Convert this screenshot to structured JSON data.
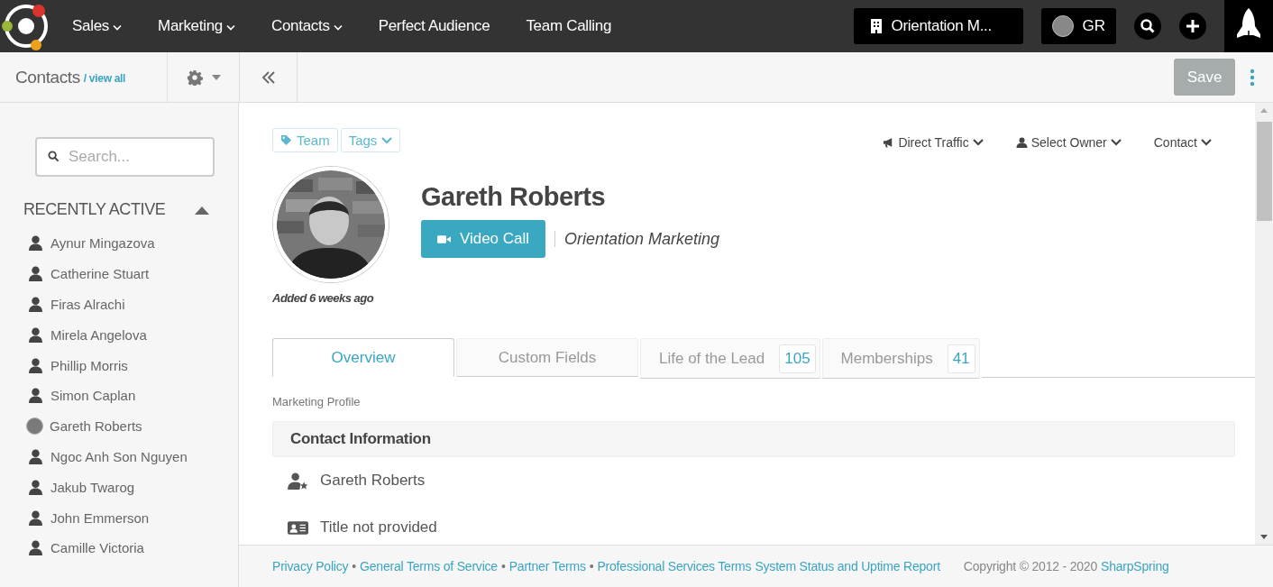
{
  "nav": {
    "menus": [
      {
        "label": "Sales",
        "dropdown": true
      },
      {
        "label": "Marketing",
        "dropdown": true
      },
      {
        "label": "Contacts",
        "dropdown": true
      },
      {
        "label": "Perfect Audience",
        "dropdown": false
      },
      {
        "label": "Team Calling",
        "dropdown": false
      }
    ],
    "company": "Orientation M...",
    "user_initials": "GR"
  },
  "toolbar": {
    "title": "Contacts",
    "view_all": "/ view all",
    "save": {
      "label": "Save",
      "disabled": true
    }
  },
  "sidebar": {
    "search": {
      "placeholder": "Search..."
    },
    "section": {
      "title": "RECENTLY ACTIVE",
      "expanded": true
    },
    "items": [
      {
        "name": "Aynur Mingazova",
        "kind": "person"
      },
      {
        "name": "Catherine Stuart",
        "kind": "person"
      },
      {
        "name": "Firas Alrachi",
        "kind": "person"
      },
      {
        "name": "Mirela Angelova",
        "kind": "person"
      },
      {
        "name": "Phillip Morris",
        "kind": "person"
      },
      {
        "name": "Simon Caplan",
        "kind": "person"
      },
      {
        "name": "Gareth Roberts",
        "kind": "avatar"
      },
      {
        "name": "Ngoc Anh Son Nguyen",
        "kind": "person"
      },
      {
        "name": "Jakub Twarog",
        "kind": "person"
      },
      {
        "name": "John Emmerson",
        "kind": "person"
      },
      {
        "name": "Camille Victoria",
        "kind": "person"
      }
    ]
  },
  "contact": {
    "tags": [
      {
        "label": "Team",
        "kind": "tag"
      },
      {
        "label": "Tags",
        "kind": "dropdown"
      }
    ],
    "selectors": [
      {
        "label": "Direct Traffic",
        "kind": "source"
      },
      {
        "label": "Select Owner",
        "kind": "owner"
      },
      {
        "label": "Contact",
        "kind": "plain"
      }
    ],
    "name": "Gareth Roberts",
    "video_call": "Video Call",
    "company": "Orientation Marketing",
    "added": "Added 6 weeks ago"
  },
  "tabs": [
    {
      "label": "Overview",
      "selected": true
    },
    {
      "label": "Custom Fields",
      "selected": false
    },
    {
      "label": "Life of the Lead",
      "count": "105",
      "selected": false
    },
    {
      "label": "Memberships",
      "count": "41",
      "selected": false
    }
  ],
  "profile": {
    "caption": "Marketing Profile",
    "section": "Contact Information",
    "fields": [
      {
        "value": "Gareth Roberts",
        "kind": "name"
      },
      {
        "value": "Title not provided",
        "kind": "title"
      }
    ]
  },
  "footer": {
    "links": [
      {
        "text": "Privacy Policy",
        "kind": "link"
      },
      {
        "text": "•",
        "kind": "sep"
      },
      {
        "text": "General Terms of Service",
        "kind": "link"
      },
      {
        "text": "•",
        "kind": "sep"
      },
      {
        "text": "Partner Terms",
        "kind": "link"
      },
      {
        "text": "•",
        "kind": "sep"
      },
      {
        "text": "Professional Services Terms",
        "kind": "link"
      },
      {
        "text": "System Status and Uptime Report",
        "kind": "link"
      }
    ],
    "copyright": "Copyright © 2012 - 2020",
    "brand": "SharpSpring"
  }
}
